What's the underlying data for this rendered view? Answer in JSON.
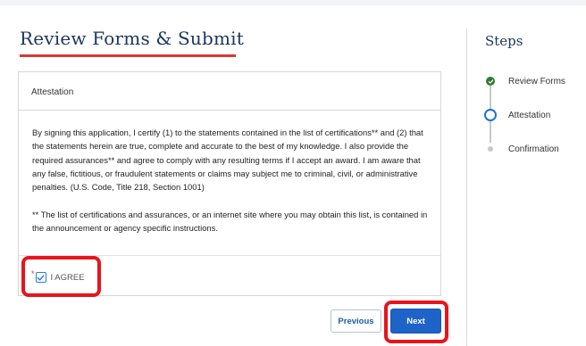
{
  "page": {
    "title": "Review Forms & Submit"
  },
  "attestation": {
    "heading": "Attestation",
    "paragraph1": "By signing this application, I certify (1) to the statements contained in the list of certifications** and (2) that the statements herein are true, complete and accurate to the best of my knowledge. I also provide the required assurances** and agree to comply with any resulting terms if I accept an award. I am aware that any false, fictitious, or fraudulent statements or claims may subject me to criminal, civil, or administrative penalties. (U.S. Code, Title 218, Section 1001)",
    "paragraph2": "** The list of certifications and assurances, or an internet site where you may obtain this list, is contained in the announcement or agency specific instructions.",
    "required_marker": "*",
    "agree_label": "I AGREE",
    "agree_checked": true
  },
  "buttons": {
    "previous": "Previous",
    "next": "Next"
  },
  "steps": {
    "title": "Steps",
    "items": [
      {
        "label": "Review Forms",
        "status": "complete",
        "icon": "check-circle-icon"
      },
      {
        "label": "Attestation",
        "status": "current",
        "icon": "current-step-ring-icon"
      },
      {
        "label": "Confirmation",
        "status": "upcoming",
        "icon": "upcoming-step-dot-icon"
      }
    ]
  },
  "colors": {
    "heading": "#1b365d",
    "accent_red": "#d83933",
    "primary_blue": "#1e63c8",
    "complete_green": "#2e7d32",
    "highlight_red": "#e8141c"
  }
}
